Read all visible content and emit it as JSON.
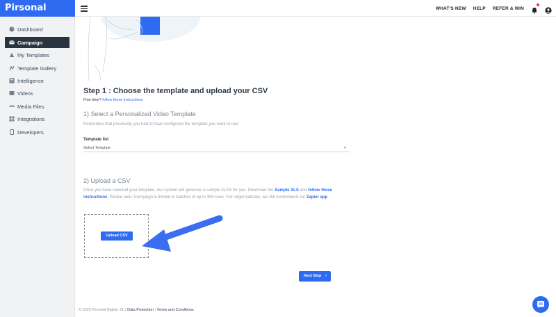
{
  "app": {
    "brand": "Pirsonal"
  },
  "topbar": {
    "links": [
      "WHAT'S NEW",
      "HELP",
      "REFER & WIN"
    ]
  },
  "sidebar": {
    "items": [
      {
        "label": "Dashboard",
        "icon": "dashboard-icon",
        "active": false
      },
      {
        "label": "Campaign",
        "icon": "envelope-icon",
        "active": true
      },
      {
        "label": "My Templates",
        "icon": "templates-icon",
        "active": false
      },
      {
        "label": "Template Gallery",
        "icon": "gallery-icon",
        "active": false
      },
      {
        "label": "Intelligence",
        "icon": "intelligence-icon",
        "active": false
      },
      {
        "label": "Videos",
        "icon": "video-icon",
        "active": false
      },
      {
        "label": "Media Files",
        "icon": "media-icon",
        "active": false
      },
      {
        "label": "Integrations",
        "icon": "grid-icon",
        "active": false
      },
      {
        "label": "Developers",
        "icon": "mobile-icon",
        "active": false
      }
    ]
  },
  "main": {
    "step_title": "Step 1 : Choose the template and upload your CSV",
    "first_time_prefix": "First time?",
    "first_time_link": "follow these instructions",
    "select_heading": "1) Select a Personalized Video Template",
    "remember_text": "Remember that previously you had to have configured the template you want to use.",
    "template_list_label": "Template list",
    "template_select_value": "Select Template",
    "upload_heading": "2) Upload a CSV",
    "upload_desc_1": "Once you have selected your template, our system will generate a sample XLSX for you. Download the",
    "sample_xls_link": "Sample XLS",
    "upload_desc_2": "and",
    "follow_link": "follow these instructions",
    "upload_desc_3": ". Please note: Campaign is limited to batches of up to 300 rows. For larger batches, we still recommend our",
    "zapier_link": "Zapier app",
    "upload_button": "Upload CSV",
    "next_button": "Next Step",
    "next_chevron": "›"
  },
  "footer": {
    "copyright": "© 2022 Pirsonal Digital, SL |",
    "data_protection": "Data Protection",
    "separator": "|",
    "terms": "Terms and Conditions"
  },
  "colors": {
    "accent": "#2f6bf0",
    "sidebar_active": "#2a3440",
    "sidebar_bg": "#f1f2f4"
  }
}
